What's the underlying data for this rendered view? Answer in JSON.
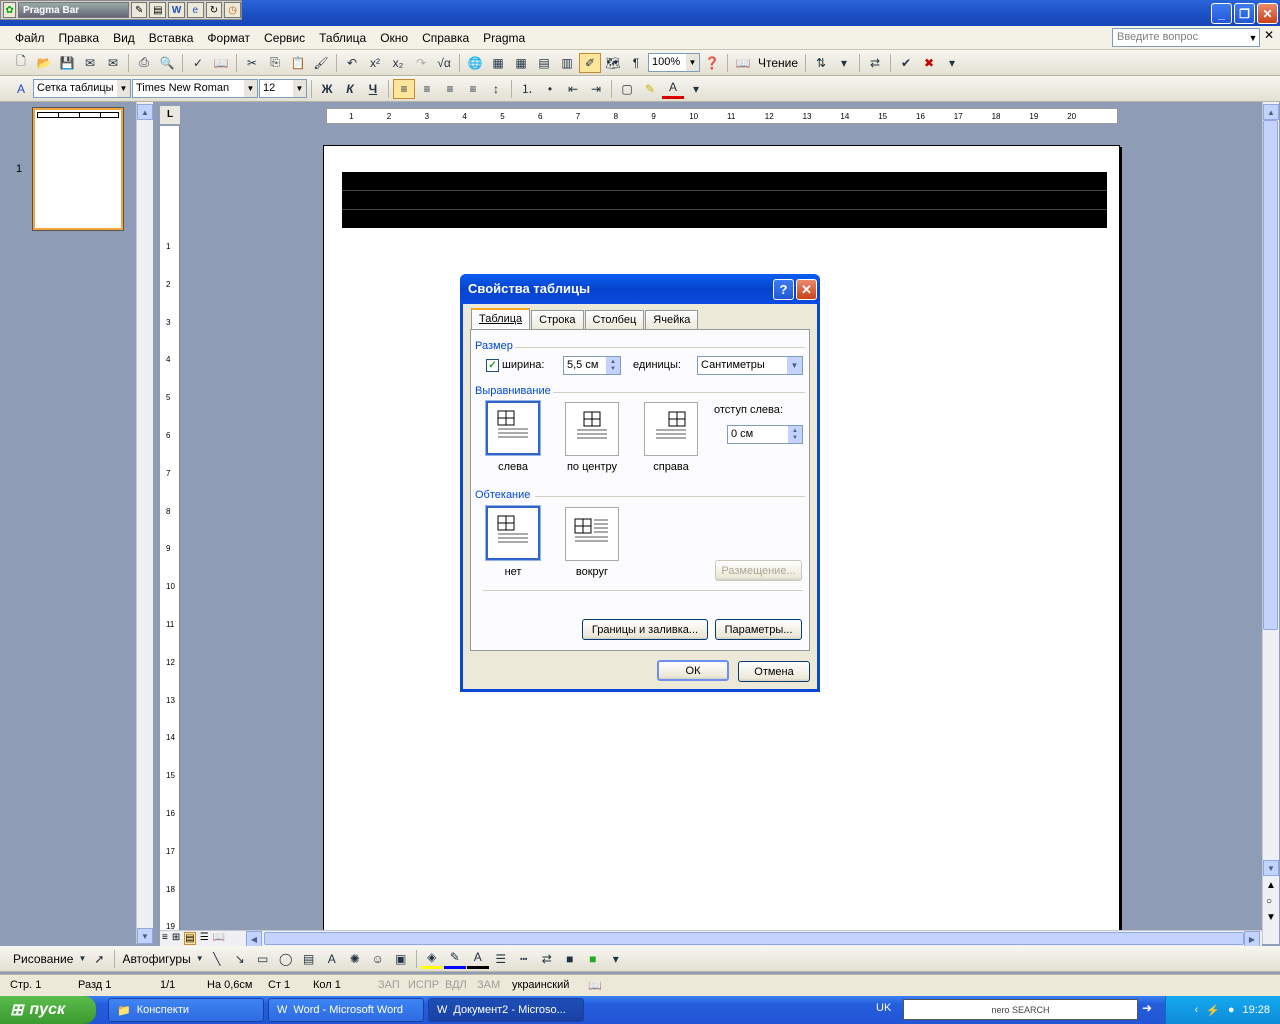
{
  "titlebar": {
    "pragma_title": "Pragma Bar"
  },
  "menu": {
    "items": [
      "Файл",
      "Правка",
      "Вид",
      "Вставка",
      "Формат",
      "Сервис",
      "Таблица",
      "Окно",
      "Справка",
      "Pragma"
    ],
    "help_placeholder": "Введите вопрос"
  },
  "toolbar1": {
    "zoom": "100%",
    "read_label": "Чтение"
  },
  "toolbar2": {
    "style": "Сетка таблицы",
    "font": "Times New Roman",
    "size": "12",
    "bold": "Ж",
    "italic": "К",
    "underline": "Ч"
  },
  "thumbnail": {
    "page_number": "1"
  },
  "ruler": {
    "h_ticks": [
      "1",
      "2",
      "3",
      "4",
      "5",
      "6",
      "7",
      "8",
      "9",
      "10",
      "11",
      "12",
      "13",
      "14",
      "15",
      "16",
      "17",
      "18",
      "19",
      "20"
    ],
    "v_ticks": [
      "1",
      "2",
      "3",
      "4",
      "5",
      "6",
      "7",
      "8",
      "9",
      "10",
      "11",
      "12",
      "13",
      "14",
      "15",
      "16",
      "17",
      "18",
      "19"
    ]
  },
  "drawbar": {
    "draw_label": "Рисование",
    "autoshapes_label": "Автофигуры"
  },
  "status": {
    "page": "Стр. 1",
    "section": "Разд 1",
    "pages": "1/1",
    "at": "На 0,6см",
    "line": "Ст 1",
    "col": "Кол 1",
    "rec": "ЗАП",
    "trk": "ИСПР",
    "ext": "ВДЛ",
    "ovr": "ЗАМ",
    "lang": "украинский"
  },
  "taskbar": {
    "start": "пуск",
    "tasks": [
      "Конспекти",
      "Word - Microsoft Word",
      "Документ2 - Microso..."
    ],
    "lang": "UK",
    "nero": "nero SEARCH",
    "clock": "19:28"
  },
  "dialog": {
    "title": "Свойства таблицы",
    "tabs": [
      "Таблица",
      "Строка",
      "Столбец",
      "Ячейка"
    ],
    "size_group": "Размер",
    "width_label": "ширина:",
    "width_checked": true,
    "width_value": "5,5 см",
    "units_label": "единицы:",
    "units_value": "Сантиметры",
    "align_group": "Выравнивание",
    "align_options": [
      "слева",
      "по центру",
      "справа"
    ],
    "indent_label": "отступ слева:",
    "indent_value": "0 см",
    "wrap_group": "Обтекание",
    "wrap_options": [
      "нет",
      "вокруг"
    ],
    "placement_button": "Размещение...",
    "borders_button": "Границы и заливка...",
    "options_button": "Параметры...",
    "ok": "ОК",
    "cancel": "Отмена"
  }
}
